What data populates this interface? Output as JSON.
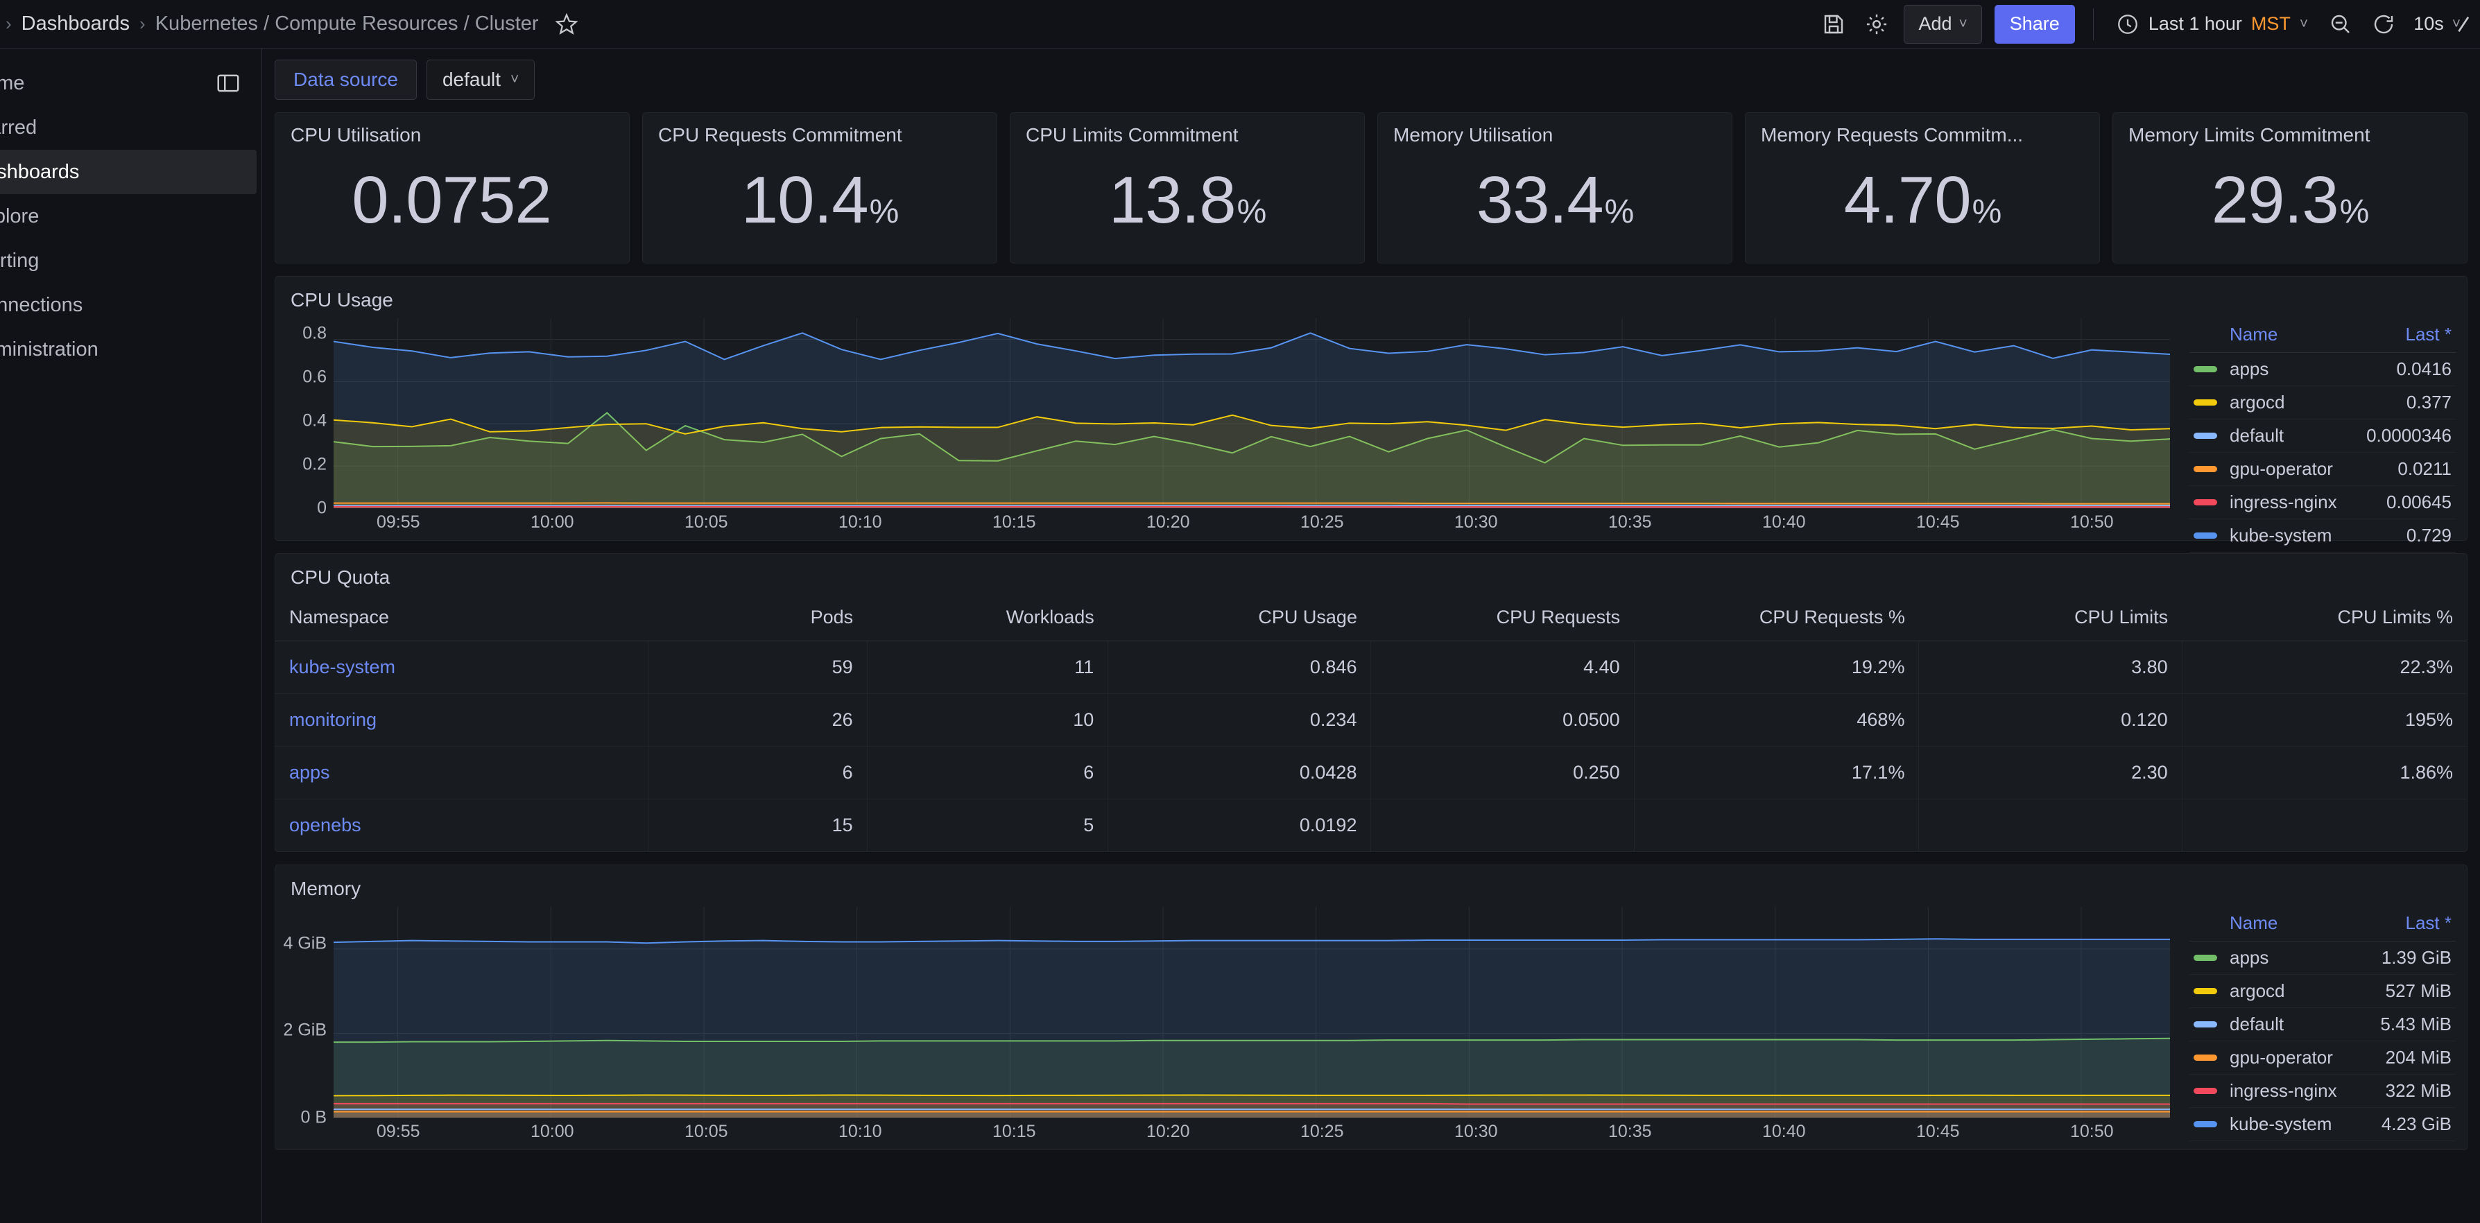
{
  "topbar": {
    "breadcrumb_root": "Dashboards",
    "breadcrumb_sep": "›",
    "breadcrumb_current": "Kubernetes / Compute Resources / Cluster",
    "star_icon": "star-icon",
    "save_icon": "save-icon",
    "settings_icon": "gear-icon",
    "add_label": "Add",
    "add_chevron": "˅",
    "share_label": "Share",
    "clock_icon": "clock-icon",
    "time_range": "Last 1 hour",
    "timezone": "MST",
    "time_chevron": "˅",
    "zoom_out_icon": "zoom-out-icon",
    "refresh_icon": "refresh-icon",
    "refresh_interval": "10s",
    "refresh_chevron": "˅"
  },
  "sidebar": {
    "dock_icon": "dock-menu-icon",
    "items": [
      {
        "label": "Home",
        "active": false
      },
      {
        "label": "Starred",
        "active": false
      },
      {
        "label": "Dashboards",
        "active": true
      },
      {
        "label": "Explore",
        "active": false
      },
      {
        "label": "Alerting",
        "active": false
      },
      {
        "label": "Connections",
        "active": false
      },
      {
        "label": "Administration",
        "active": false
      }
    ]
  },
  "controls": {
    "datasource_label": "Data source",
    "datasource_value": "default",
    "datasource_chevron": "˅"
  },
  "stats": [
    {
      "title": "CPU Utilisation",
      "value": "0.0752",
      "unit": ""
    },
    {
      "title": "CPU Requests Commitment",
      "value": "10.4",
      "unit": "%"
    },
    {
      "title": "CPU Limits Commitment",
      "value": "13.8",
      "unit": "%"
    },
    {
      "title": "Memory Utilisation",
      "value": "33.4",
      "unit": "%"
    },
    {
      "title": "Memory Requests Commitm...",
      "value": "4.70",
      "unit": "%"
    },
    {
      "title": "Memory Limits Commitment",
      "value": "29.3",
      "unit": "%"
    }
  ],
  "cpu_usage_panel": {
    "title": "CPU Usage",
    "legend_header": {
      "name": "Name",
      "last": "Last *"
    }
  },
  "cpu_quota_panel": {
    "title": "CPU Quota",
    "columns": [
      "Namespace",
      "Pods",
      "Workloads",
      "CPU Usage",
      "CPU Requests",
      "CPU Requests %",
      "CPU Limits",
      "CPU Limits %"
    ],
    "rows": [
      {
        "namespace": "kube-system",
        "pods": "59",
        "workloads": "11",
        "cpu_usage": "0.846",
        "cpu_requests": "4.40",
        "cpu_requests_pct": "19.2%",
        "cpu_limits": "3.80",
        "cpu_limits_pct": "22.3%"
      },
      {
        "namespace": "monitoring",
        "pods": "26",
        "workloads": "10",
        "cpu_usage": "0.234",
        "cpu_requests": "0.0500",
        "cpu_requests_pct": "468%",
        "cpu_limits": "0.120",
        "cpu_limits_pct": "195%"
      },
      {
        "namespace": "apps",
        "pods": "6",
        "workloads": "6",
        "cpu_usage": "0.0428",
        "cpu_requests": "0.250",
        "cpu_requests_pct": "17.1%",
        "cpu_limits": "2.30",
        "cpu_limits_pct": "1.86%"
      },
      {
        "namespace": "openebs",
        "pods": "15",
        "workloads": "5",
        "cpu_usage": "0.0192",
        "cpu_requests": "",
        "cpu_requests_pct": "",
        "cpu_limits": "",
        "cpu_limits_pct": ""
      }
    ]
  },
  "memory_panel": {
    "title": "Memory",
    "legend_header": {
      "name": "Name",
      "last": "Last *"
    }
  },
  "colors": {
    "green": "#73bf69",
    "yellow": "#f2cc0c",
    "light_blue": "#8ab8ff",
    "orange": "#ff9830",
    "red": "#f2495c",
    "blue": "#5794f2",
    "purple": "#b877d9",
    "accent_blue": "#6e8bf5",
    "share_blue": "#5b6af0",
    "tz_orange": "#ff9830",
    "panel_bg": "#181b1f",
    "page_bg": "#111217",
    "text": "#ccccdc"
  },
  "chart_data": [
    {
      "type": "area",
      "title": "CPU Usage",
      "xlabel": "",
      "ylabel": "",
      "ylim": [
        0,
        0.9
      ],
      "yticks": [
        "0",
        "0.2",
        "0.4",
        "0.6",
        "0.8"
      ],
      "ytick_values": [
        0,
        0.2,
        0.4,
        0.6,
        0.8
      ],
      "xticks": [
        "09:55",
        "10:00",
        "10:05",
        "10:10",
        "10:15",
        "10:20",
        "10:25",
        "10:30",
        "10:35",
        "10:40",
        "10:45",
        "10:50"
      ],
      "grid": true,
      "legend_position": "right",
      "stacked": false,
      "series": [
        {
          "name": "apps",
          "color": "#73bf69",
          "last": "0.0416",
          "values": [
            0.315,
            0.292,
            0.293,
            0.296,
            0.335,
            0.318,
            0.307,
            0.452,
            0.274,
            0.391,
            0.325,
            0.312,
            0.35,
            0.245,
            0.33,
            0.352,
            0.226,
            0.224,
            0.272,
            0.318,
            0.302,
            0.34,
            0.305,
            0.262,
            0.339,
            0.292,
            0.34,
            0.267,
            0.33,
            0.37,
            0.29,
            0.215,
            0.33,
            0.298,
            0.3,
            0.3,
            0.342,
            0.29,
            0.31,
            0.368,
            0.35,
            0.352,
            0.28,
            0.325,
            0.372,
            0.33,
            0.318,
            0.328
          ]
        },
        {
          "name": "argocd",
          "color": "#f2cc0c",
          "last": "0.377",
          "values": [
            0.418,
            0.405,
            0.386,
            0.422,
            0.362,
            0.366,
            0.382,
            0.397,
            0.4,
            0.352,
            0.388,
            0.405,
            0.377,
            0.362,
            0.382,
            0.385,
            0.383,
            0.383,
            0.433,
            0.403,
            0.399,
            0.404,
            0.395,
            0.441,
            0.392,
            0.378,
            0.403,
            0.4,
            0.41,
            0.393,
            0.369,
            0.42,
            0.398,
            0.384,
            0.395,
            0.402,
            0.381,
            0.4,
            0.406,
            0.397,
            0.393,
            0.377,
            0.396,
            0.382,
            0.378,
            0.389,
            0.371,
            0.377
          ]
        },
        {
          "name": "default",
          "color": "#8ab8ff",
          "last": "0.0000346",
          "values": [
            0.012,
            0.012,
            0.012,
            0.012,
            0.012,
            0.012,
            0.012,
            0.012,
            0.012,
            0.012,
            0.012,
            0.012,
            0.012,
            0.012,
            0.012,
            0.012,
            0.012,
            0.012,
            0.012,
            0.012,
            0.012,
            0.012,
            0.012,
            0.012,
            0.012,
            0.012,
            0.012,
            0.012,
            0.013,
            0.013,
            0.013,
            0.013,
            0.013,
            0.013,
            0.013,
            0.013,
            0.013,
            0.013,
            0.013,
            0.013,
            0.013,
            0.013,
            0.013,
            0.013,
            0.013,
            0.013,
            0.013,
            0.013
          ]
        },
        {
          "name": "gpu-operator",
          "color": "#ff9830",
          "last": "0.0211",
          "values": [
            0.024,
            0.024,
            0.024,
            0.024,
            0.024,
            0.024,
            0.024,
            0.025,
            0.024,
            0.024,
            0.024,
            0.024,
            0.024,
            0.024,
            0.024,
            0.024,
            0.024,
            0.024,
            0.024,
            0.024,
            0.024,
            0.024,
            0.024,
            0.024,
            0.024,
            0.024,
            0.024,
            0.024,
            0.023,
            0.023,
            0.023,
            0.023,
            0.023,
            0.023,
            0.023,
            0.023,
            0.022,
            0.022,
            0.022,
            0.022,
            0.022,
            0.022,
            0.022,
            0.022,
            0.021,
            0.021,
            0.021,
            0.021
          ]
        },
        {
          "name": "ingress-nginx",
          "color": "#f2495c",
          "last": "0.00645",
          "values": [
            0.007,
            0.007,
            0.007,
            0.007,
            0.007,
            0.007,
            0.007,
            0.007,
            0.007,
            0.007,
            0.007,
            0.007,
            0.007,
            0.007,
            0.007,
            0.007,
            0.007,
            0.007,
            0.007,
            0.007,
            0.007,
            0.007,
            0.007,
            0.007,
            0.007,
            0.006,
            0.006,
            0.006,
            0.006,
            0.006,
            0.006,
            0.006,
            0.006,
            0.006,
            0.006,
            0.006,
            0.006,
            0.006,
            0.006,
            0.006,
            0.006,
            0.006,
            0.006,
            0.006,
            0.006,
            0.006,
            0.006,
            0.006
          ]
        },
        {
          "name": "kube-system",
          "color": "#5794f2",
          "last": "0.729",
          "values": [
            0.79,
            0.762,
            0.745,
            0.713,
            0.735,
            0.741,
            0.717,
            0.72,
            0.748,
            0.79,
            0.705,
            0.77,
            0.83,
            0.752,
            0.705,
            0.748,
            0.785,
            0.828,
            0.778,
            0.745,
            0.709,
            0.725,
            0.73,
            0.731,
            0.76,
            0.83,
            0.757,
            0.734,
            0.743,
            0.775,
            0.755,
            0.727,
            0.738,
            0.765,
            0.723,
            0.747,
            0.774,
            0.741,
            0.745,
            0.76,
            0.742,
            0.79,
            0.74,
            0.77,
            0.71,
            0.75,
            0.74,
            0.729
          ]
        }
      ]
    },
    {
      "type": "area",
      "title": "Memory",
      "xlabel": "",
      "ylabel": "",
      "ylim": [
        0,
        5
      ],
      "yticks": [
        "0 B",
        "2 GiB",
        "4 GiB"
      ],
      "ytick_values": [
        0,
        2,
        4
      ],
      "xticks": [
        "09:55",
        "10:00",
        "10:05",
        "10:10",
        "10:15",
        "10:20",
        "10:25",
        "10:30",
        "10:35",
        "10:40",
        "10:45",
        "10:50"
      ],
      "grid": true,
      "legend_position": "right",
      "stacked": false,
      "series": [
        {
          "name": "apps",
          "color": "#73bf69",
          "last": "1.39 GiB",
          "values": [
            1.79,
            1.79,
            1.8,
            1.8,
            1.8,
            1.81,
            1.82,
            1.83,
            1.82,
            1.81,
            1.81,
            1.81,
            1.81,
            1.81,
            1.82,
            1.82,
            1.82,
            1.82,
            1.82,
            1.82,
            1.82,
            1.83,
            1.83,
            1.83,
            1.83,
            1.83,
            1.83,
            1.84,
            1.84,
            1.84,
            1.84,
            1.84,
            1.85,
            1.85,
            1.85,
            1.85,
            1.85,
            1.85,
            1.85,
            1.85,
            1.84,
            1.84,
            1.84,
            1.84,
            1.85,
            1.86,
            1.87,
            1.88
          ]
        },
        {
          "name": "argocd",
          "color": "#f2cc0c",
          "last": "527 MiB",
          "values": [
            0.52,
            0.522,
            0.528,
            0.532,
            0.531,
            0.528,
            0.526,
            0.53,
            0.535,
            0.532,
            0.528,
            0.526,
            0.53,
            0.534,
            0.532,
            0.529,
            0.526,
            0.525,
            0.527,
            0.529,
            0.531,
            0.533,
            0.534,
            0.532,
            0.53,
            0.529,
            0.528,
            0.527,
            0.529,
            0.531,
            0.533,
            0.535,
            0.534,
            0.532,
            0.53,
            0.529,
            0.528,
            0.527,
            0.527,
            0.527,
            0.528,
            0.529,
            0.53,
            0.529,
            0.528,
            0.527,
            0.527,
            0.527
          ]
        },
        {
          "name": "default",
          "color": "#8ab8ff",
          "last": "5.43 MiB",
          "values": [
            0.2,
            0.2,
            0.2,
            0.2,
            0.2,
            0.2,
            0.2,
            0.2,
            0.2,
            0.2,
            0.2,
            0.2,
            0.2,
            0.2,
            0.2,
            0.2,
            0.2,
            0.2,
            0.2,
            0.2,
            0.2,
            0.2,
            0.2,
            0.2,
            0.2,
            0.2,
            0.2,
            0.2,
            0.2,
            0.2,
            0.2,
            0.2,
            0.2,
            0.2,
            0.2,
            0.2,
            0.2,
            0.2,
            0.2,
            0.2,
            0.2,
            0.2,
            0.2,
            0.2,
            0.2,
            0.2,
            0.2,
            0.2
          ]
        },
        {
          "name": "gpu-operator",
          "color": "#ff9830",
          "last": "204 MiB",
          "values": [
            0.14,
            0.14,
            0.14,
            0.14,
            0.14,
            0.14,
            0.14,
            0.14,
            0.14,
            0.14,
            0.14,
            0.14,
            0.14,
            0.14,
            0.14,
            0.14,
            0.14,
            0.14,
            0.14,
            0.14,
            0.14,
            0.14,
            0.14,
            0.14,
            0.14,
            0.14,
            0.14,
            0.14,
            0.14,
            0.14,
            0.14,
            0.14,
            0.14,
            0.14,
            0.14,
            0.14,
            0.14,
            0.14,
            0.14,
            0.14,
            0.14,
            0.14,
            0.14,
            0.14,
            0.14,
            0.14,
            0.14,
            0.14
          ]
        },
        {
          "name": "ingress-nginx",
          "color": "#f2495c",
          "last": "322 MiB",
          "values": [
            0.33,
            0.33,
            0.33,
            0.33,
            0.33,
            0.33,
            0.33,
            0.33,
            0.33,
            0.33,
            0.33,
            0.33,
            0.33,
            0.33,
            0.33,
            0.33,
            0.33,
            0.33,
            0.33,
            0.33,
            0.33,
            0.33,
            0.33,
            0.33,
            0.33,
            0.33,
            0.33,
            0.33,
            0.33,
            0.32,
            0.32,
            0.32,
            0.32,
            0.32,
            0.32,
            0.32,
            0.32,
            0.32,
            0.32,
            0.32,
            0.32,
            0.32,
            0.32,
            0.32,
            0.32,
            0.32,
            0.32,
            0.32
          ]
        },
        {
          "name": "kube-system",
          "color": "#5794f2",
          "last": "4.23 GiB",
          "values": [
            4.16,
            4.18,
            4.2,
            4.19,
            4.18,
            4.17,
            4.17,
            4.17,
            4.14,
            4.17,
            4.19,
            4.2,
            4.18,
            4.17,
            4.17,
            4.18,
            4.19,
            4.2,
            4.19,
            4.18,
            4.18,
            4.19,
            4.2,
            4.2,
            4.2,
            4.2,
            4.2,
            4.2,
            4.21,
            4.21,
            4.21,
            4.21,
            4.21,
            4.21,
            4.22,
            4.22,
            4.22,
            4.22,
            4.22,
            4.22,
            4.23,
            4.24,
            4.23,
            4.23,
            4.23,
            4.23,
            4.23,
            4.23
          ]
        }
      ]
    }
  ]
}
